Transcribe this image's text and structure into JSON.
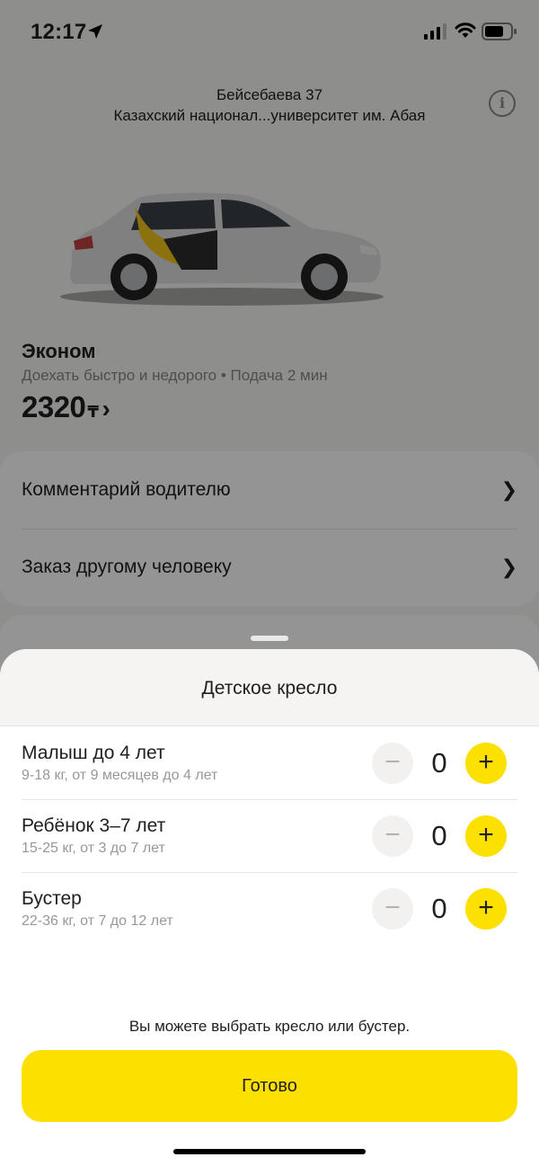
{
  "status_bar": {
    "time": "12:17"
  },
  "header": {
    "from": "Бейсебаева 37",
    "to": "Казахский национал...университет им. Абая",
    "info_icon": "info-icon"
  },
  "tariff": {
    "name": "Эконом",
    "description": "Доехать быстро и недорого • Подача 2 мин",
    "price": "2320",
    "currency": "₸",
    "chevron": "›"
  },
  "options": [
    {
      "label": "Комментарий водителю"
    },
    {
      "label": "Заказ другому человеку"
    }
  ],
  "sheet": {
    "title": "Детское кресло",
    "seats": [
      {
        "title": "Малыш до 4 лет",
        "subtitle": "9-18 кг, от 9 месяцев до 4 лет",
        "count": "0"
      },
      {
        "title": "Ребёнок 3–7 лет",
        "subtitle": "15-25 кг, от 3 до 7 лет",
        "count": "0"
      },
      {
        "title": "Бустер",
        "subtitle": "22-36 кг, от 7 до 12 лет",
        "count": "0"
      }
    ],
    "minus_label": "−",
    "plus_label": "+",
    "hint": "Вы можете выбрать кресло или бустер.",
    "done_label": "Готово"
  },
  "colors": {
    "accent": "#fce000",
    "text": "#21201f",
    "secondary_text": "#9a9895"
  }
}
